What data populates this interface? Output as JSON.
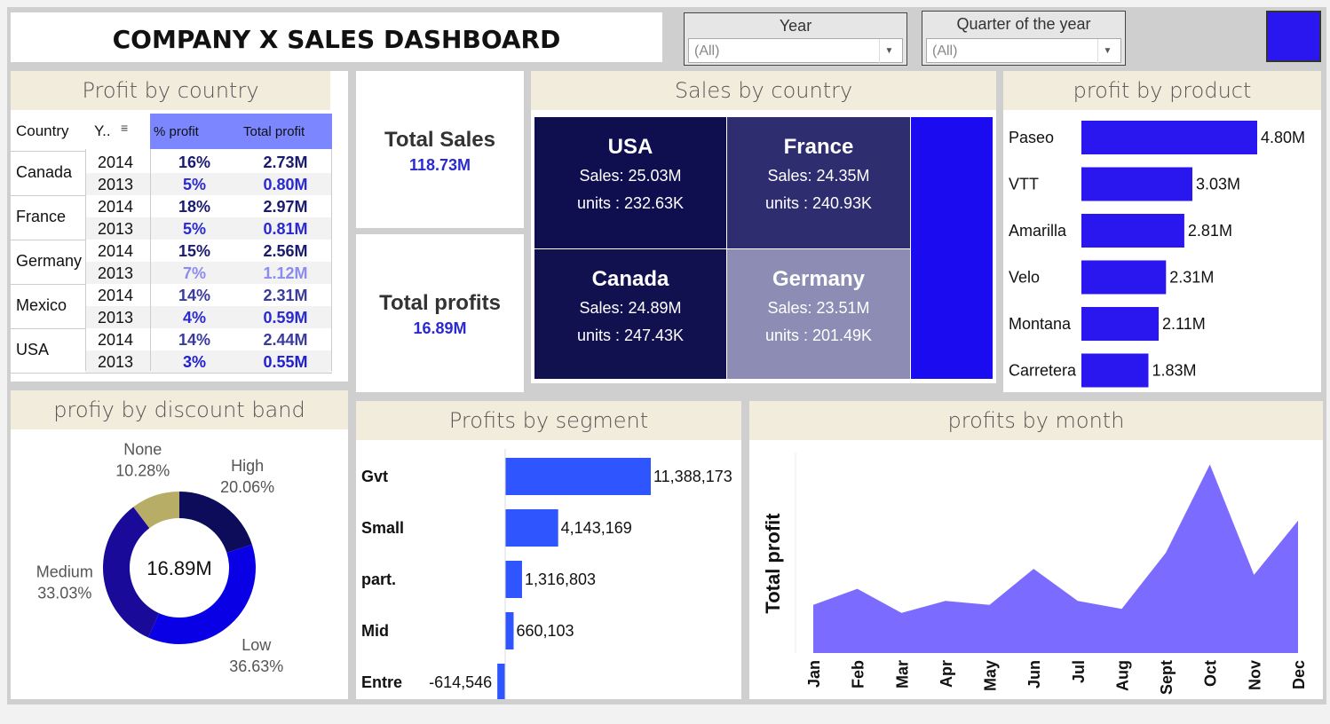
{
  "header": {
    "title": "COMPANY X SALES DASHBOARD"
  },
  "filters": [
    {
      "label": "Year",
      "value": "(All)"
    },
    {
      "label": "Quarter of the year",
      "value": "(All)"
    }
  ],
  "accent_color": "#2a17f0",
  "profit_by_country": {
    "title": "Profit by country",
    "headers": {
      "country": "Country",
      "year": "Y..",
      "pct": "% profit",
      "total": "Total profit"
    },
    "rows": [
      {
        "country": "Canada",
        "years": [
          {
            "year": "2014",
            "pct": "16%",
            "total": "2.73M",
            "color": "#1a1a6e"
          },
          {
            "year": "2013",
            "pct": "5%",
            "total": "0.80M",
            "color": "#2a2ad0"
          }
        ]
      },
      {
        "country": "France",
        "years": [
          {
            "year": "2014",
            "pct": "18%",
            "total": "2.97M",
            "color": "#1a1a6e"
          },
          {
            "year": "2013",
            "pct": "5%",
            "total": "0.81M",
            "color": "#2a2ad0"
          }
        ]
      },
      {
        "country": "Germany",
        "years": [
          {
            "year": "2014",
            "pct": "15%",
            "total": "2.56M",
            "color": "#1a1a6e"
          },
          {
            "year": "2013",
            "pct": "7%",
            "total": "1.12M",
            "color": "#8b8bf0"
          }
        ]
      },
      {
        "country": "Mexico",
        "years": [
          {
            "year": "2014",
            "pct": "14%",
            "total": "2.31M",
            "color": "#3b3b9e"
          },
          {
            "year": "2013",
            "pct": "4%",
            "total": "0.59M",
            "color": "#2a2ad0"
          }
        ]
      },
      {
        "country": "USA",
        "years": [
          {
            "year": "2014",
            "pct": "14%",
            "total": "2.44M",
            "color": "#3b3b9e"
          },
          {
            "year": "2013",
            "pct": "3%",
            "total": "0.55M",
            "color": "#2020d0"
          }
        ]
      }
    ]
  },
  "kpis": {
    "total_sales_label": "Total Sales",
    "total_sales_value": "118.73M",
    "total_profits_label": "Total profits",
    "total_profits_value": "16.89M"
  },
  "sales_by_country": {
    "title": "Sales by country",
    "sales_label": "Sales:",
    "units_label": "units :",
    "cells": [
      {
        "name": "USA",
        "sales": "25.03M",
        "units": "232.63K",
        "color": "#0f0f4f"
      },
      {
        "name": "France",
        "sales": "24.35M",
        "units": "240.93K",
        "color": "#2d2d6f"
      },
      {
        "name": "Canada",
        "sales": "24.89M",
        "units": "247.43K",
        "color": "#111150"
      },
      {
        "name": "Germany",
        "sales": "23.51M",
        "units": "201.49K",
        "color": "#8c8cb4"
      }
    ],
    "extra_color": "#1a0bf0"
  },
  "chart_data": [
    {
      "type": "bar",
      "title": "profit by product",
      "categories": [
        "Paseo",
        "VTT",
        "Amarilla",
        "Velo",
        "Montana",
        "Carretera"
      ],
      "values": [
        4.8,
        3.03,
        2.81,
        2.31,
        2.11,
        1.83
      ],
      "value_labels": [
        "4.80M",
        "3.03M",
        "2.81M",
        "2.31M",
        "2.11M",
        "1.83M"
      ],
      "color": "#2a17f0"
    },
    {
      "type": "pie",
      "title": "profiy by discount band",
      "center_label": "16.89M",
      "slices": [
        {
          "name": "High",
          "pct": 20.06,
          "label": "20.06%",
          "color": "#0c0c5a"
        },
        {
          "name": "Low",
          "pct": 36.63,
          "label": "36.63%",
          "color": "#0a00e6"
        },
        {
          "name": "Medium",
          "pct": 33.03,
          "label": "33.03%",
          "color": "#1a0a9a"
        },
        {
          "name": "None",
          "pct": 10.28,
          "label": "10.28%",
          "color": "#b8ad66"
        }
      ]
    },
    {
      "type": "bar",
      "title": "Profits by segment",
      "categories": [
        "Gvt",
        "Small",
        "part.",
        "Mid",
        "Entre"
      ],
      "values": [
        11388173,
        4143169,
        1316803,
        660103,
        -614546
      ],
      "value_labels": [
        "11,388,173",
        "4,143,169",
        "1,316,803",
        "660,103",
        "-614,546"
      ],
      "color": "#2f55ff"
    },
    {
      "type": "area",
      "title": "profits by month",
      "ylabel": "Total profit",
      "categories": [
        "Jan",
        "Feb",
        "Mar",
        "Apr",
        "May",
        "Jun",
        "Jul",
        "Aug",
        "Sept",
        "Oct",
        "Nov",
        "Dec"
      ],
      "values": [
        1.2,
        1.6,
        1.0,
        1.3,
        1.2,
        2.1,
        1.3,
        1.1,
        2.5,
        4.7,
        1.95,
        3.3
      ],
      "ylim": [
        0,
        5
      ],
      "color": "#7b6cff"
    }
  ]
}
